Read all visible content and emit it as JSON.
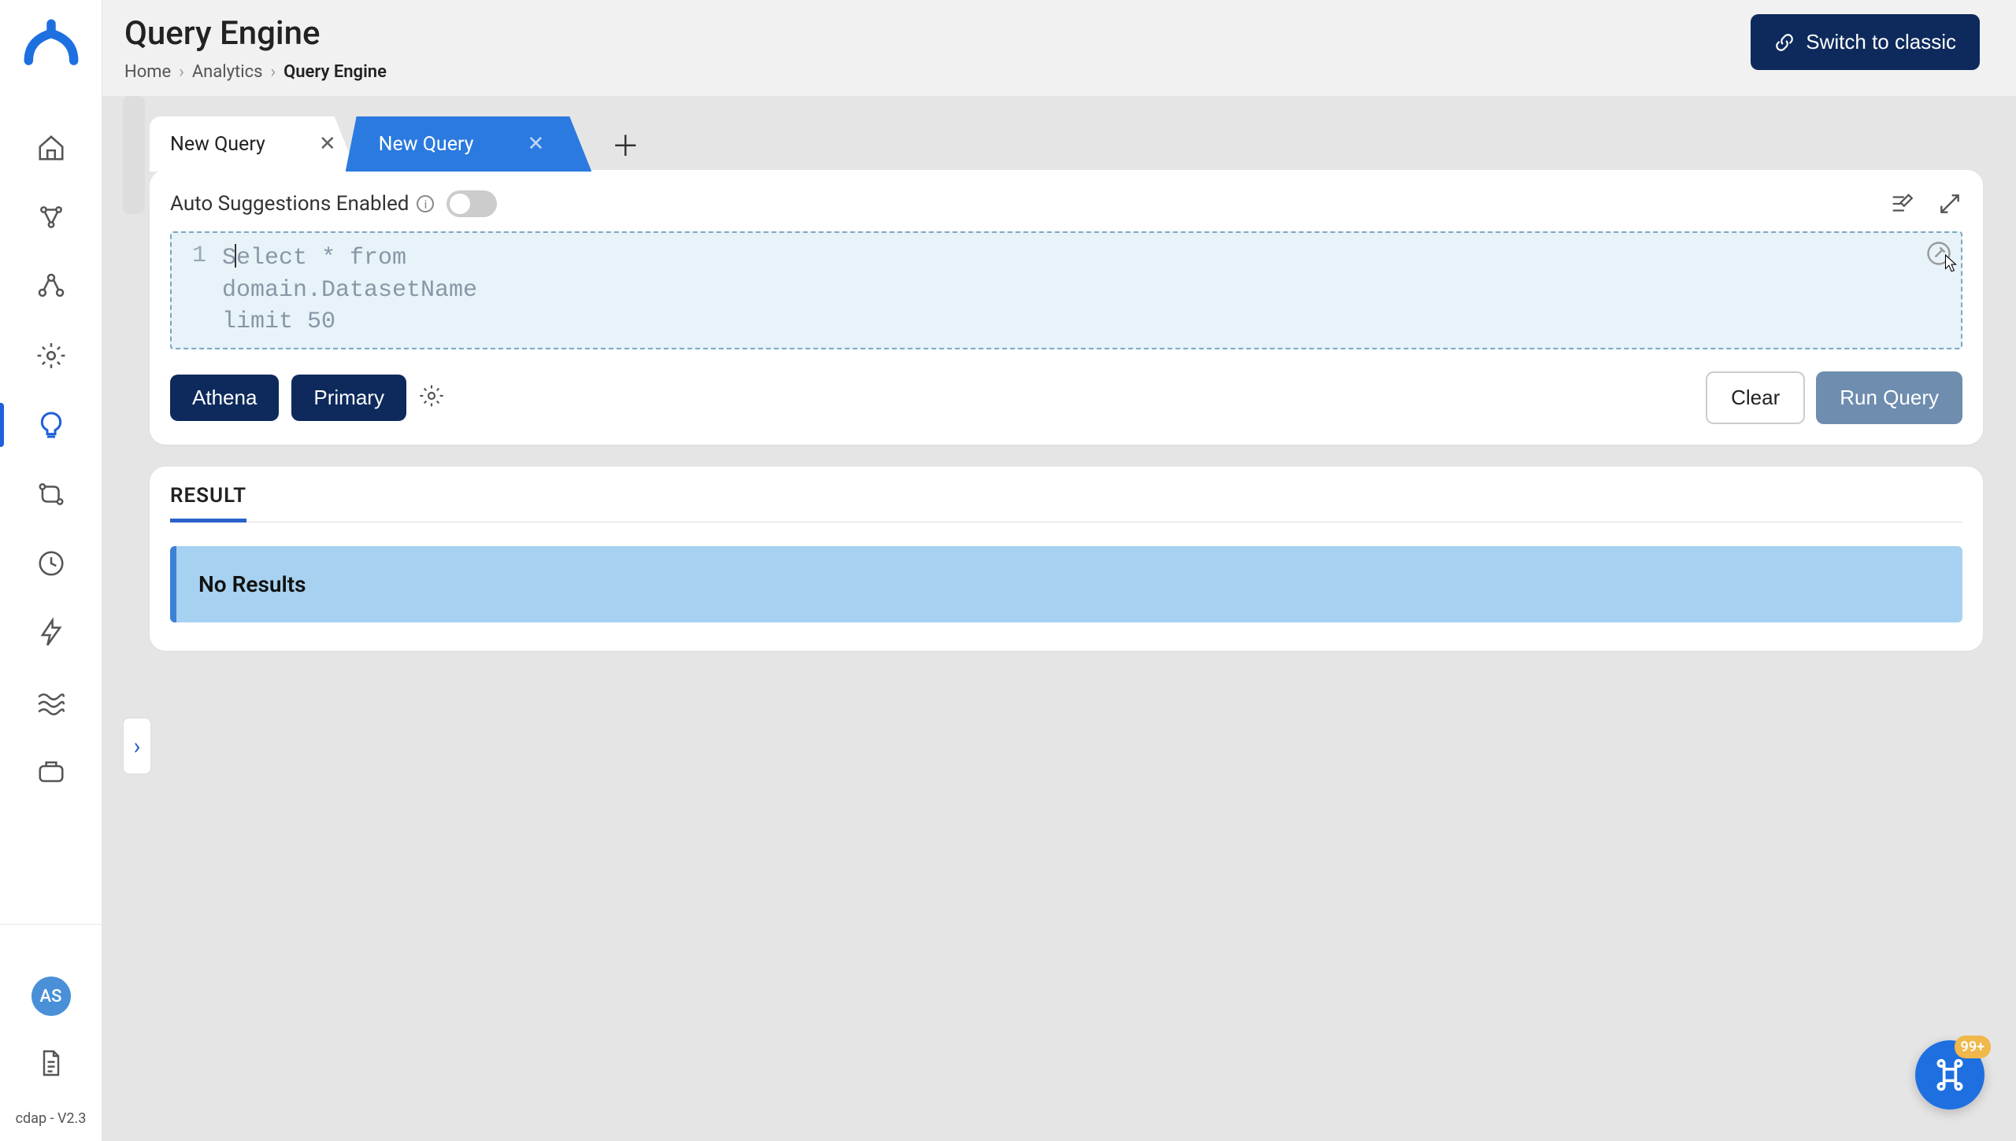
{
  "header": {
    "title": "Query Engine",
    "switch_label": "Switch to classic"
  },
  "breadcrumb": {
    "home": "Home",
    "analytics": "Analytics",
    "current": "Query Engine"
  },
  "sidebar": {
    "user_initials": "AS",
    "version": "cdap - V2.3"
  },
  "tabs": {
    "tab1": "New Query",
    "tab2": "New Query"
  },
  "query_panel": {
    "autosuggest_label": "Auto Suggestions Enabled",
    "autosuggest_on": false,
    "line_number": "1",
    "placeholder": "Select * from\ndomain.DatasetName\nlimit 50",
    "engine_chip": "Athena",
    "source_chip": "Primary",
    "clear_label": "Clear",
    "run_label": "Run Query"
  },
  "result": {
    "header": "RESULT",
    "message": "No Results"
  },
  "fab": {
    "badge": "99+"
  }
}
